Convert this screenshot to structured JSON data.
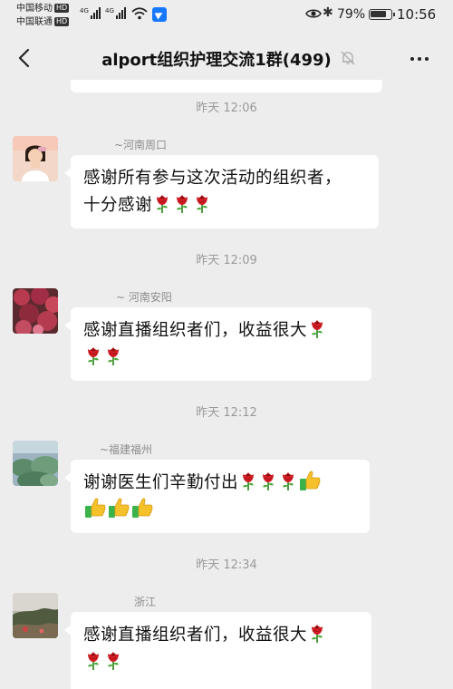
{
  "status_bar": {
    "carrier1": "中国移动",
    "carrier2": "中国联通",
    "hd_badge": "HD",
    "network": "4G",
    "battery": "79%",
    "time": "10:56"
  },
  "header": {
    "title": "alport组织护理交流1群(499)"
  },
  "messages": [
    {
      "timestamp": "昨天 12:06",
      "sender": "~河南周口",
      "line1": "感谢所有参与这次活动的组织者，",
      "line2": "十分感谢"
    },
    {
      "timestamp": "昨天 12:09",
      "sender": "~ 河南安阳",
      "line1": "感谢直播组织者们，收益很大"
    },
    {
      "timestamp": "昨天 12:12",
      "sender": "~福建福州",
      "line1": "谢谢医生们辛勤付出"
    },
    {
      "timestamp": "昨天 12:34",
      "sender": "浙江",
      "line1": "感谢直播组织者们，收益很大"
    }
  ],
  "icons": {
    "back": "back-arrow-icon",
    "mute": "bell-off-icon",
    "more": "more-dots-icon",
    "rose": "rose-emoji-icon",
    "thumbs_up": "thumbs-up-emoji-icon"
  },
  "colors": {
    "background": "#ededed",
    "bubble": "#ffffff",
    "timestamp": "#9a9a9a"
  }
}
